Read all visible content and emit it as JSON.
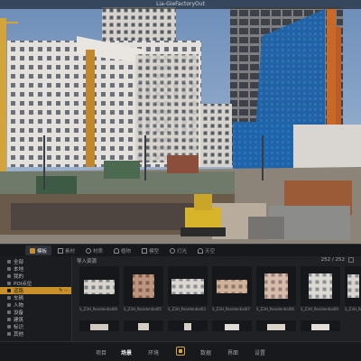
{
  "window": {
    "title": "Lia-GieFactoryOut"
  },
  "panel": {
    "tabs": [
      {
        "label": "模板",
        "icon": "folder-icon"
      },
      {
        "label": "素材",
        "icon": "image-icon"
      },
      {
        "label": "材质",
        "icon": "sphere-icon"
      },
      {
        "label": "植物",
        "icon": "tree-icon"
      },
      {
        "label": "模型",
        "icon": "cube-icon"
      },
      {
        "label": "灯光",
        "icon": "light-icon"
      },
      {
        "label": "天空",
        "icon": "sky-icon"
      }
    ],
    "active_tab": 0,
    "tree": [
      {
        "label": "全部"
      },
      {
        "label": "本地"
      },
      {
        "label": "我的"
      },
      {
        "label": "POI点位"
      },
      {
        "label": "道路"
      },
      {
        "label": "车辆"
      },
      {
        "label": "人物"
      },
      {
        "label": "设备"
      },
      {
        "label": "建筑"
      },
      {
        "label": "标识"
      },
      {
        "label": "其他"
      }
    ],
    "tree_selected": 4,
    "breadcrumb": "导入资源",
    "count": "252 / 252",
    "assets": [
      {
        "caption": "S_Z3H_Residential08"
      },
      {
        "caption": "S_Z3H_Residential05"
      },
      {
        "caption": "S_Z3H_Residential03"
      },
      {
        "caption": "S_Z3H_Residential07"
      },
      {
        "caption": "S_Z3H_Residential06"
      },
      {
        "caption": "S_Z3H_Residential09"
      },
      {
        "caption": "S_Z3H_Residential10"
      }
    ]
  },
  "bottom_bar": {
    "tabs": [
      "项目",
      "场景",
      "环境",
      "数据",
      "界面",
      "设置"
    ],
    "active": 1
  },
  "colors": {
    "accent": "#c8902a",
    "panel_bg": "#1f2125",
    "selected_text": "#1a1a1a"
  }
}
